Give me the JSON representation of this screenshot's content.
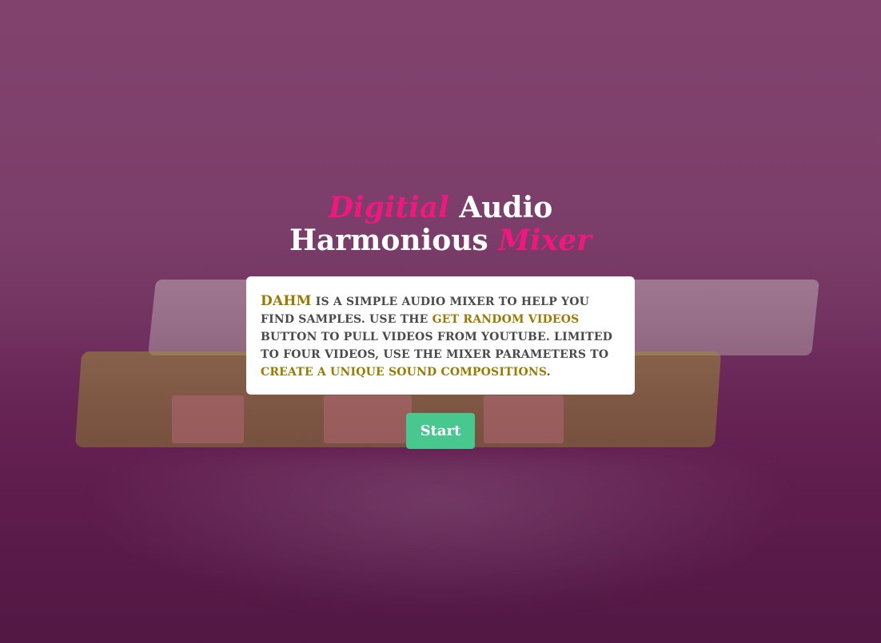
{
  "title": {
    "line1_accent": "Digitial",
    "line1_rest": "Audio",
    "line2_rest": "Harmonious",
    "line2_accent": "Mixer"
  },
  "intro": {
    "brand": "DAHM",
    "text1": "IS A SIMPLE AUDIO MIXER TO HELP YOU FIND SAMPLES. USE THE",
    "highlight1": "GET RANDOM VIDEOS",
    "text2": "BUTTON TO PULL VIDEOS FROM YOUTUBE. LIMITED TO FOUR VIDEOS, USE THE MIXER PARAMETERS TO",
    "highlight2": "CREATE A UNIQUE SOUND COMPOSITIONS",
    "text3": "."
  },
  "start_button": {
    "label": "Start"
  },
  "colors": {
    "accent_pink": "#f0177f",
    "highlight_gold": "#9a7a00",
    "button_green": "#48c78e",
    "background_purple": "#7d456c"
  }
}
